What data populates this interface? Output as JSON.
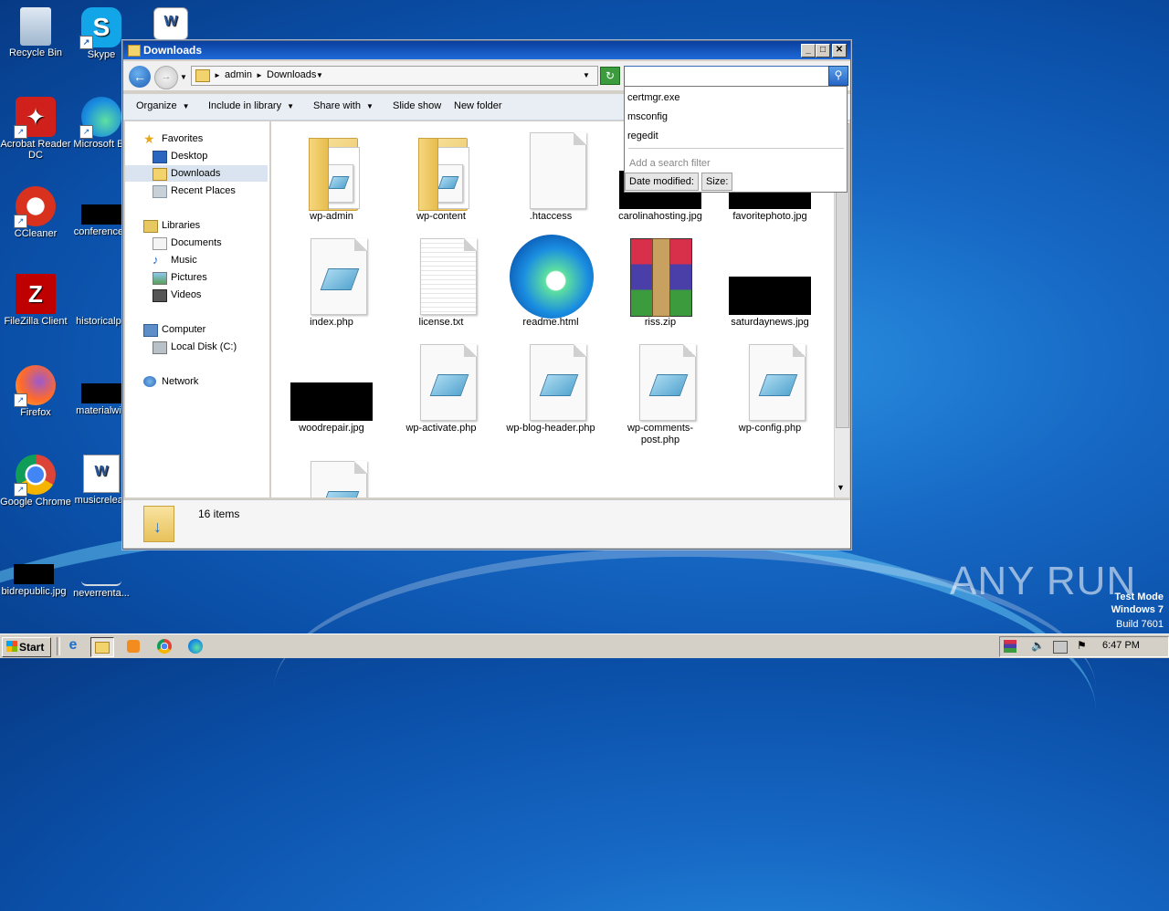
{
  "desktop": {
    "icons": [
      {
        "label": "Recycle Bin"
      },
      {
        "label": "Skype"
      },
      {
        "label": "Acrobat Reader DC"
      },
      {
        "label": "Microsoft Ed"
      },
      {
        "label": "CCleaner"
      },
      {
        "label": "conferenced"
      },
      {
        "label": "FileZilla Client"
      },
      {
        "label": "historicalpa"
      },
      {
        "label": "Firefox"
      },
      {
        "label": "materialwin"
      },
      {
        "label": "Google Chrome"
      },
      {
        "label": "musicreleas"
      },
      {
        "label": "bidrepublic.jpg"
      },
      {
        "label": "neverrenta..."
      }
    ],
    "watermark": {
      "line1": "Test Mode",
      "line2": "Windows 7",
      "line3": "Build 7601"
    },
    "brand": "ANY RUN"
  },
  "window": {
    "title": "Downloads",
    "breadcrumb": [
      "admin",
      "Downloads"
    ],
    "search": {
      "value": "",
      "placeholder": ""
    },
    "toolbar": [
      "Organize",
      "Include in library",
      "Share with",
      "Slide show",
      "New folder"
    ],
    "nav": {
      "favorites": "Favorites",
      "desktop": "Desktop",
      "downloads": "Downloads",
      "recent": "Recent Places",
      "libraries": "Libraries",
      "documents": "Documents",
      "music": "Music",
      "pictures": "Pictures",
      "videos": "Videos",
      "computer": "Computer",
      "localdisk": "Local Disk (C:)",
      "network": "Network"
    },
    "files": [
      {
        "name": "wp-admin",
        "kind": "folder"
      },
      {
        "name": "wp-content",
        "kind": "folder"
      },
      {
        "name": ".htaccess",
        "kind": "blank"
      },
      {
        "name": "carolinahosting.jpg",
        "kind": "image"
      },
      {
        "name": "favoritephoto.jpg",
        "kind": "image"
      },
      {
        "name": "index.php",
        "kind": "php"
      },
      {
        "name": "license.txt",
        "kind": "text"
      },
      {
        "name": "readme.html",
        "kind": "edge"
      },
      {
        "name": "riss.zip",
        "kind": "zip"
      },
      {
        "name": "saturdaynews.jpg",
        "kind": "image"
      },
      {
        "name": "woodrepair.jpg",
        "kind": "image"
      },
      {
        "name": "wp-activate.php",
        "kind": "php"
      },
      {
        "name": "wp-blog-header.php",
        "kind": "php"
      },
      {
        "name": "wp-comments-post.php",
        "kind": "php"
      },
      {
        "name": "wp-config.php",
        "kind": "php"
      },
      {
        "name": "",
        "kind": "php"
      }
    ],
    "status": "16 items",
    "search_dropdown": {
      "suggestions": [
        "certmgr.exe",
        "msconfig",
        "regedit"
      ],
      "filter_hint": "Add a search filter",
      "filters": [
        "Date modified:",
        "Size:"
      ]
    }
  },
  "taskbar": {
    "start": "Start",
    "clock": "6:47 PM"
  }
}
